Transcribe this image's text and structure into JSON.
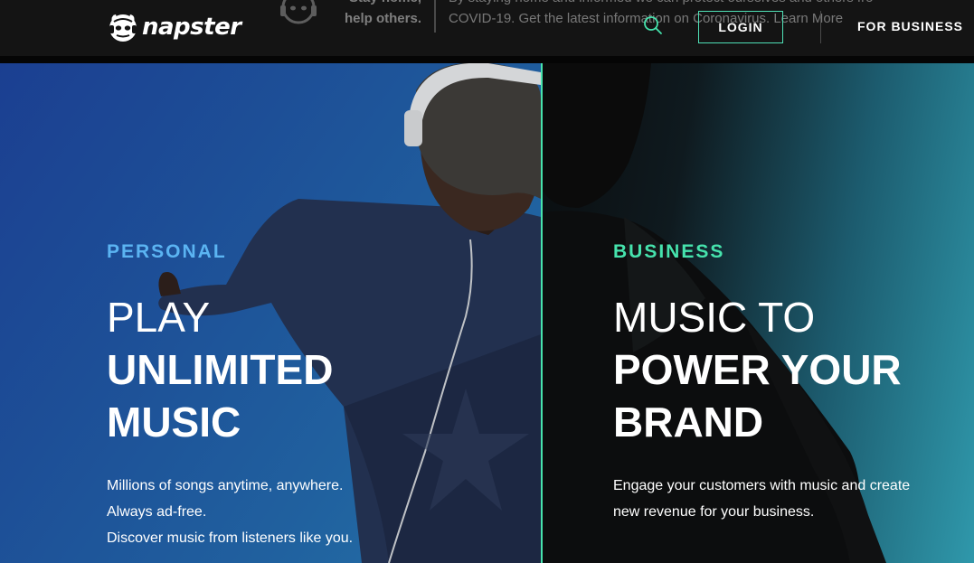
{
  "header": {
    "logo_text": "napster",
    "covid": {
      "stay_line1": "Stay home,",
      "stay_line2": "help others.",
      "message_line1": "By staying home and informed we can protect ourselves and others from",
      "message_line2": "COVID-19. Get the latest information on Coronavirus. Learn More"
    },
    "login_label": "LOGIN",
    "business_label": "FOR BUSINESS"
  },
  "personal": {
    "eyebrow": "PERSONAL",
    "headline_thin": "PLAY",
    "headline_bold_1": "UNLIMITED",
    "headline_bold_2": "MUSIC",
    "desc_1": "Millions of songs anytime, anywhere.",
    "desc_2": "Always ad-free.",
    "desc_3": "Discover music from listeners like you."
  },
  "business": {
    "eyebrow": "BUSINESS",
    "headline_thin": "MUSIC TO",
    "headline_bold_1": "POWER YOUR",
    "headline_bold_2": "BRAND",
    "desc_1": "Engage your customers with music and create",
    "desc_2": "new revenue for your business."
  },
  "colors": {
    "personal_accent": "#5bb4f2",
    "business_accent": "#46e3ad",
    "login_border": "#4fe0b6"
  },
  "icons": {
    "logo": "napster-cat-icon",
    "covid": "headphones-cat-icon",
    "search": "search-icon"
  }
}
